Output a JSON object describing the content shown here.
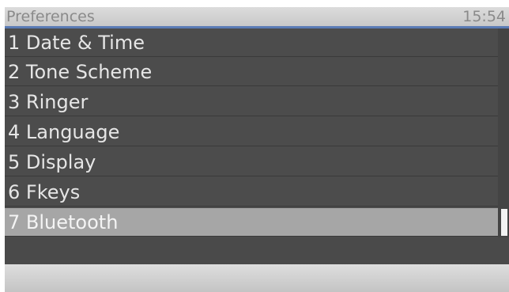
{
  "titlebar": {
    "title": "Preferences",
    "clock": "15:54"
  },
  "menu": {
    "items": [
      {
        "label": "1 Date & Time"
      },
      {
        "label": "2 Tone Scheme"
      },
      {
        "label": "3 Ringer"
      },
      {
        "label": "4 Language"
      },
      {
        "label": "5 Display"
      },
      {
        "label": "6 Fkeys"
      },
      {
        "label": "7 Bluetooth",
        "selected": true
      }
    ]
  },
  "colors": {
    "list_background": "#4c4c4c",
    "selected_row": "#a6a6a6",
    "accent_line": "#5a7bb5",
    "title_text": "#8a8a8a"
  }
}
